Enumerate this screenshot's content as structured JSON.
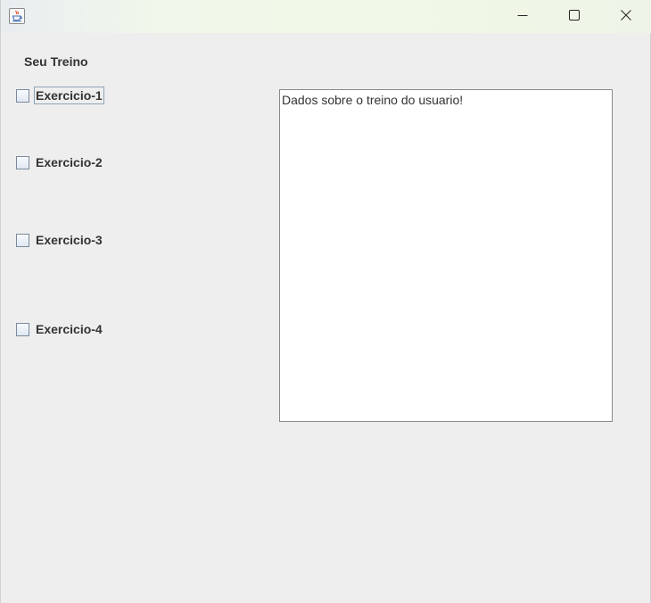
{
  "window": {
    "controls": {
      "minimize_icon": "minimize-icon",
      "maximize_icon": "maximize-icon",
      "close_icon": "close-icon"
    },
    "app_icon": "java-coffee-cup-icon"
  },
  "main": {
    "heading": "Seu Treino",
    "exercises": [
      {
        "label": "Exercicio-1",
        "checked": false
      },
      {
        "label": "Exercicio-2",
        "checked": false
      },
      {
        "label": "Exercicio-3",
        "checked": false
      },
      {
        "label": "Exercicio-4",
        "checked": false
      }
    ],
    "info_text": "Dados sobre o treino do usuario!"
  }
}
